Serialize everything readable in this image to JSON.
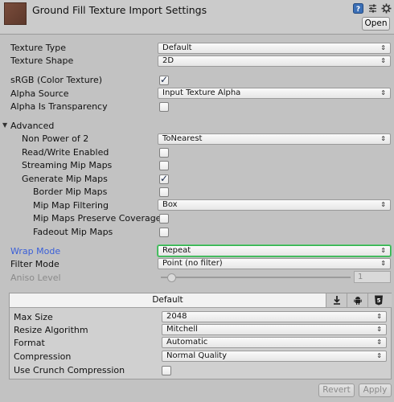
{
  "header": {
    "title": "Ground Fill Texture Import Settings",
    "open_label": "Open",
    "icons": [
      "help-icon",
      "preset-icon",
      "settings-gear-icon"
    ]
  },
  "settings": {
    "texture_type": {
      "label": "Texture Type",
      "value": "Default"
    },
    "texture_shape": {
      "label": "Texture Shape",
      "value": "2D"
    },
    "srgb": {
      "label": "sRGB (Color Texture)",
      "checked": true
    },
    "alpha_source": {
      "label": "Alpha Source",
      "value": "Input Texture Alpha"
    },
    "alpha_transparency": {
      "label": "Alpha Is Transparency",
      "checked": false
    },
    "advanced": {
      "label": "Advanced",
      "expanded": true
    },
    "non_power_of_2": {
      "label": "Non Power of 2",
      "value": "ToNearest"
    },
    "read_write": {
      "label": "Read/Write Enabled",
      "checked": false
    },
    "streaming_mip": {
      "label": "Streaming Mip Maps",
      "checked": false
    },
    "generate_mip": {
      "label": "Generate Mip Maps",
      "checked": true
    },
    "border_mip": {
      "label": "Border Mip Maps",
      "checked": false
    },
    "mip_filtering": {
      "label": "Mip Map Filtering",
      "value": "Box"
    },
    "mip_coverage": {
      "label": "Mip Maps Preserve Coverage",
      "checked": false
    },
    "fadeout_mip": {
      "label": "Fadeout Mip Maps",
      "checked": false
    },
    "wrap_mode": {
      "label": "Wrap Mode",
      "value": "Repeat"
    },
    "filter_mode": {
      "label": "Filter Mode",
      "value": "Point (no filter)"
    },
    "aniso_level": {
      "label": "Aniso Level",
      "value": "1",
      "level": 1
    }
  },
  "platform": {
    "tab_default": "Default",
    "tabs": [
      "standalone-icon",
      "android-icon",
      "html5-icon"
    ],
    "max_size": {
      "label": "Max Size",
      "value": "2048"
    },
    "resize_algorithm": {
      "label": "Resize Algorithm",
      "value": "Mitchell"
    },
    "format": {
      "label": "Format",
      "value": "Automatic"
    },
    "compression": {
      "label": "Compression",
      "value": "Normal Quality"
    },
    "crunch": {
      "label": "Use Crunch Compression",
      "checked": false
    }
  },
  "footer": {
    "revert_label": "Revert",
    "apply_label": "Apply"
  },
  "colors": {
    "wrap_mode_label": "#3a5fd8",
    "wrap_mode_highlight": "#2fb24d"
  }
}
